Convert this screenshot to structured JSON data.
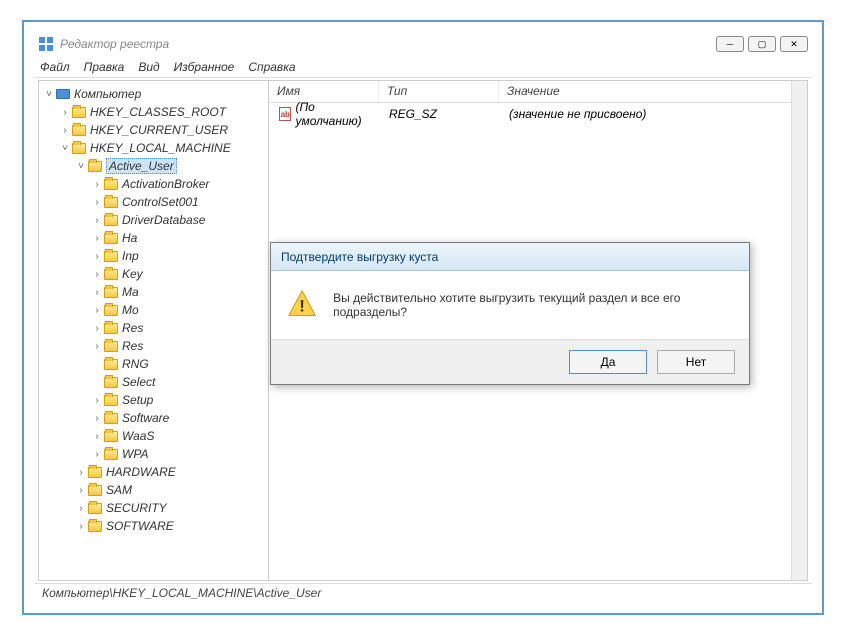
{
  "window": {
    "title": "Редактор реестра"
  },
  "menu": {
    "file": "Файл",
    "edit": "Правка",
    "view": "Вид",
    "favorites": "Избранное",
    "help": "Справка"
  },
  "tree": {
    "root": "Компьютер",
    "hkcr": "HKEY_CLASSES_ROOT",
    "hkcu": "HKEY_CURRENT_USER",
    "hklm": "HKEY_LOCAL_MACHINE",
    "active_user": "Active_User",
    "children": {
      "activationbroker": "ActivationBroker",
      "controlset001": "ControlSet001",
      "driverdatabase": "DriverDatabase",
      "ha": "Ha",
      "inp": "Inp",
      "key": "Key",
      "ma": "Ma",
      "mo": "Mo",
      "res1": "Res",
      "res2": "Res",
      "rng": "RNG",
      "select": "Select",
      "setup": "Setup",
      "software": "Software",
      "waas": "WaaS",
      "wpa": "WPA"
    },
    "hardware": "HARDWARE",
    "sam": "SAM",
    "security": "SECURITY",
    "software_key": "SOFTWARE"
  },
  "list": {
    "header": {
      "name": "Имя",
      "type": "Тип",
      "value": "Значение"
    },
    "row": {
      "name": "(По умолчанию)",
      "type": "REG_SZ",
      "value": "(значение не присвоено)"
    }
  },
  "statusbar": "Компьютер\\HKEY_LOCAL_MACHINE\\Active_User",
  "dialog": {
    "title": "Подтвердите выгрузку куста",
    "message": "Вы действительно хотите выгрузить текущий раздел и все его подразделы?",
    "yes": "Да",
    "no": "Нет"
  }
}
